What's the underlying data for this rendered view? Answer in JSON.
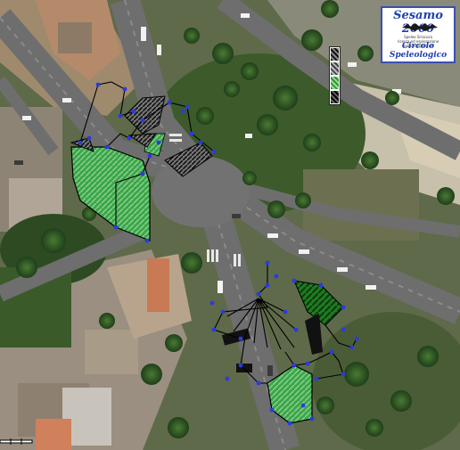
{
  "logo": {
    "title": "Sesamo 2000",
    "line1": "Speleo Siracusa",
    "line2": "ricerca ed esplorazione",
    "line3": "sesamo2000.net",
    "subtitle": "Circolo Speleologico"
  },
  "colors": {
    "survey_points": "#2a3be0",
    "cave_fill": "#2e9a2e",
    "legend_border": "#222222"
  },
  "legend_icons": [
    "hatch-dark-icon",
    "hatch-gray-icon",
    "green-area-icon",
    "hatch-black-icon"
  ]
}
